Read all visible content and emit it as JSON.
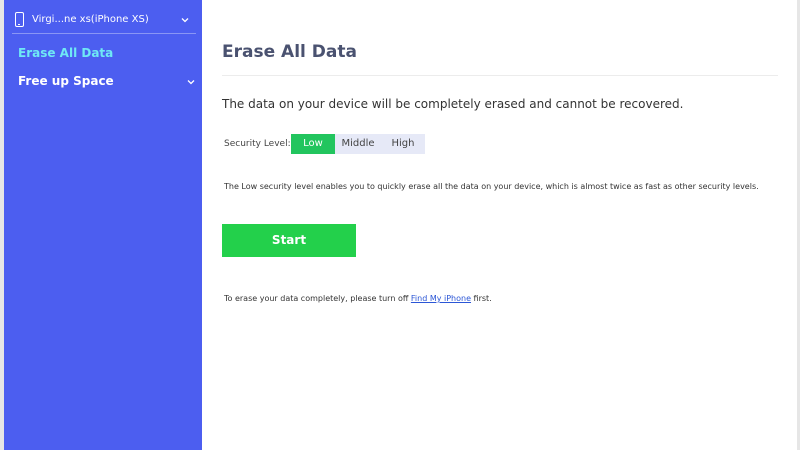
{
  "sidebar": {
    "device_name": "Virgi...ne xs(iPhone XS)",
    "device_icon": "phone-icon",
    "items": [
      {
        "label": "Erase All Data",
        "active": true
      },
      {
        "label": "Free up Space",
        "active": false
      }
    ]
  },
  "main": {
    "title": "Erase All Data",
    "warning": "The data on your device will be completely erased and cannot be recovered.",
    "security": {
      "label": "Security Level:",
      "levels": [
        "Low",
        "Middle",
        "High"
      ],
      "selected": "Low"
    },
    "description": "The Low security level enables you to quickly erase all the data on your device, which is almost twice as fast as other security levels.",
    "start_label": "Start",
    "footer": {
      "prefix": "To erase your data completely, please turn off ",
      "link": "Find My iPhone",
      "suffix": " first."
    }
  },
  "colors": {
    "sidebar_bg": "#4c5ef0",
    "active_nav": "#6fe8f5",
    "start_button": "#23d04b",
    "selected_level": "#22c55e",
    "link": "#2b56d6"
  }
}
